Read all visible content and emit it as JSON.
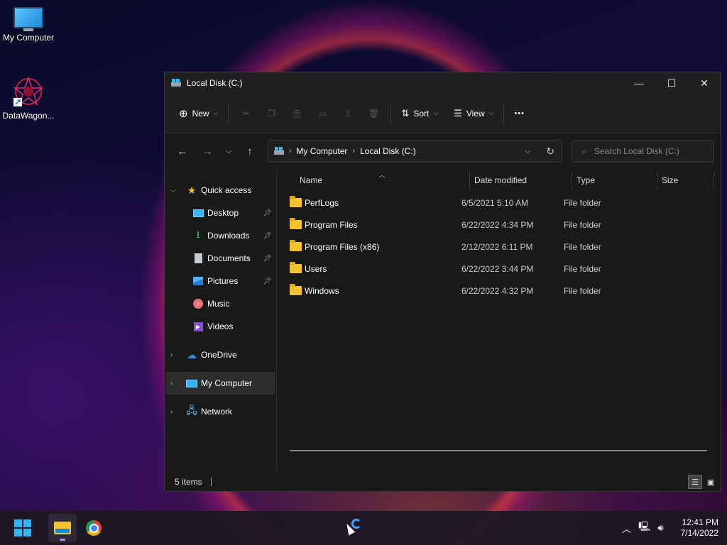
{
  "desktop": {
    "icons": [
      {
        "label": "My Computer",
        "icon": "computer-icon"
      },
      {
        "label": "DataWagon...",
        "icon": "datawagon-shortcut-icon"
      }
    ]
  },
  "window": {
    "title": "Local Disk (C:)",
    "controls": {
      "minimize": "—",
      "maximize": "☐",
      "close": "✕"
    }
  },
  "commandbar": {
    "new_label": "New",
    "sort_label": "Sort",
    "view_label": "View",
    "more_label": "•••"
  },
  "address": {
    "crumbs": [
      "My Computer",
      "Local Disk (C:)"
    ],
    "search_placeholder": "Search Local Disk (C:)"
  },
  "nav": {
    "quick_access": "Quick access",
    "items": [
      {
        "label": "Desktop",
        "pinned": true
      },
      {
        "label": "Downloads",
        "pinned": true
      },
      {
        "label": "Documents",
        "pinned": true
      },
      {
        "label": "Pictures",
        "pinned": true
      },
      {
        "label": "Music",
        "pinned": false
      },
      {
        "label": "Videos",
        "pinned": false
      }
    ],
    "onedrive": "OneDrive",
    "my_computer": "My Computer",
    "network": "Network"
  },
  "columns": {
    "name": "Name",
    "date": "Date modified",
    "type": "Type",
    "size": "Size"
  },
  "files": [
    {
      "name": "PerfLogs",
      "date": "6/5/2021 5:10 AM",
      "type": "File folder"
    },
    {
      "name": "Program Files",
      "date": "6/22/2022 4:34 PM",
      "type": "File folder"
    },
    {
      "name": "Program Files (x86)",
      "date": "2/12/2022 6:11 PM",
      "type": "File folder"
    },
    {
      "name": "Users",
      "date": "6/22/2022 3:44 PM",
      "type": "File folder"
    },
    {
      "name": "Windows",
      "date": "6/22/2022 4:32 PM",
      "type": "File folder"
    }
  ],
  "status": {
    "items_count": "5 items"
  },
  "taskbar": {
    "time": "12:41 PM",
    "date": "7/14/2022"
  }
}
